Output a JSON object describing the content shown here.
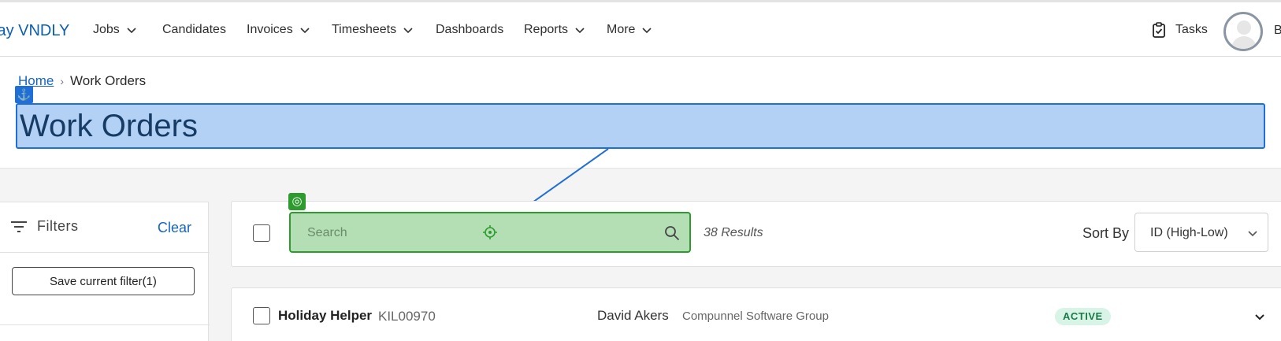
{
  "app": {
    "brand": "lay VNDLY"
  },
  "nav": {
    "items": [
      {
        "label": "Jobs",
        "has_menu": true
      },
      {
        "label": "Candidates",
        "has_menu": false
      },
      {
        "label": "Invoices",
        "has_menu": true
      },
      {
        "label": "Timesheets",
        "has_menu": true
      },
      {
        "label": "Dashboards",
        "has_menu": false
      },
      {
        "label": "Reports",
        "has_menu": true
      },
      {
        "label": "More",
        "has_menu": true
      }
    ],
    "tasks_label": "Tasks",
    "user_initial": "B"
  },
  "breadcrumb": {
    "home": "Home",
    "current": "Work Orders"
  },
  "page": {
    "title": "Work Orders"
  },
  "filters": {
    "heading": "Filters",
    "clear_label": "Clear",
    "save_label": "Save current filter(1)"
  },
  "toolbar": {
    "search_placeholder": "Search",
    "results_text": "38 Results",
    "sort_label": "Sort By",
    "sort_value": "ID (High-Low)"
  },
  "work_orders": [
    {
      "title": "Holiday Helper",
      "id": "KIL00970",
      "person": "David Akers",
      "vendor": "Compunnel Software Group",
      "status": "ACTIVE"
    }
  ],
  "colors": {
    "brand": "#0b5fb0",
    "link": "#1565c0",
    "highlight_blue": "#b3d1f4",
    "highlight_green": "#b4dfb4",
    "status_active_bg": "#d8f4e6",
    "status_active_text": "#1c7a4a"
  },
  "icons": {
    "anchor": "anchor-icon",
    "target": "target-icon",
    "search": "search-icon",
    "crosshair": "crosshair-icon",
    "tasks": "clipboard-check-icon",
    "filters": "filter-lines-icon"
  }
}
